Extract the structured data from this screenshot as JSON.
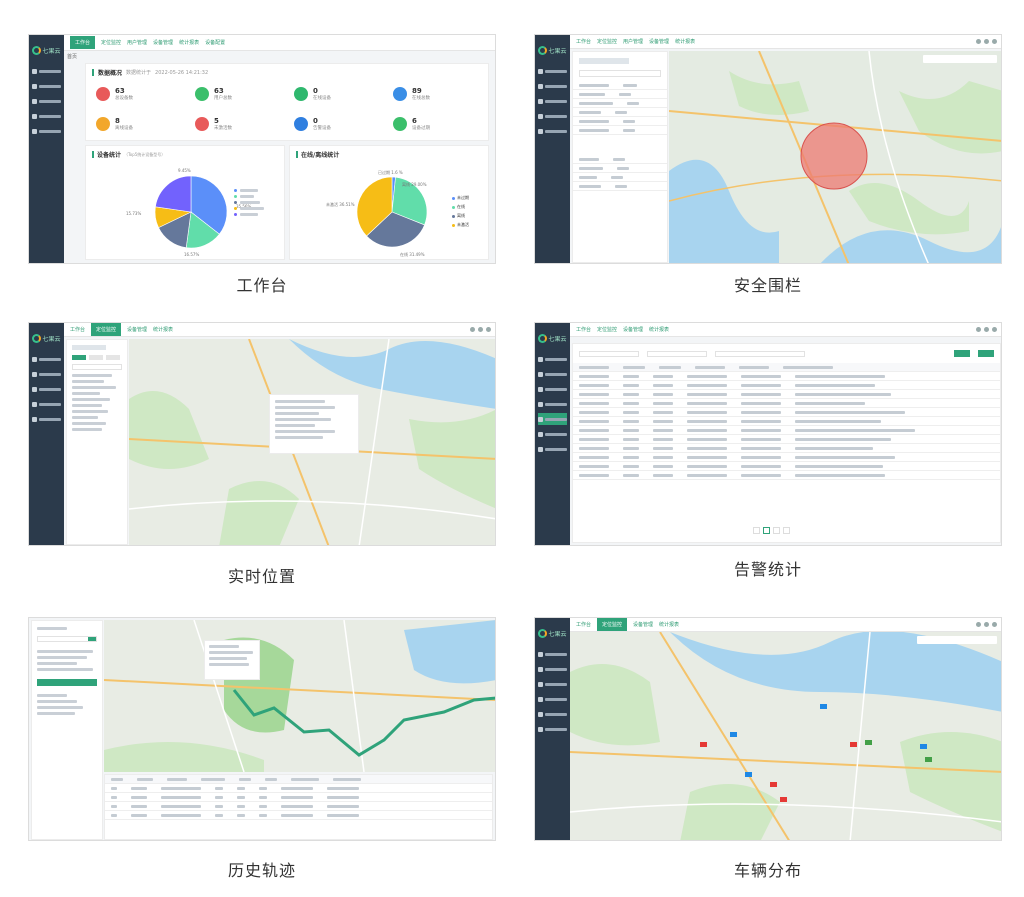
{
  "captions": [
    "工作台",
    "安全围栏",
    "实时位置",
    "告警统计",
    "历史轨迹",
    "车辆分布"
  ],
  "brand": "七果云",
  "workbench": {
    "top_tabs": [
      "工作台",
      "定位监控",
      "用户管理",
      "设备管理",
      "统计报表",
      "设备配置"
    ],
    "breadcrumb": "首页",
    "overview_title": "数据概况",
    "overview_subtitle": "数据统计于",
    "overview_time": "2022-05-26 14:21:32",
    "stats": [
      {
        "value": "63",
        "label": "总设备数",
        "color": "#e85a5a"
      },
      {
        "value": "63",
        "label": "用户总数",
        "color": "#3bbf6b"
      },
      {
        "value": "0",
        "label": "在线设备",
        "color": "#2fb86e"
      },
      {
        "value": "89",
        "label": "在线总数",
        "color": "#3a8ee6"
      },
      {
        "value": "8",
        "label": "离线设备",
        "color": "#f2a72b"
      },
      {
        "value": "5",
        "label": "未激活数",
        "color": "#e85a5a"
      },
      {
        "value": "0",
        "label": "告警设备",
        "color": "#2f7fe0"
      },
      {
        "value": "6",
        "label": "设备过期",
        "color": "#3bbf6b"
      }
    ],
    "card1_title": "设备统计",
    "card1_sub": "（Top5统计设备型号）",
    "card2_title": "在线/离线统计",
    "chart_left": {
      "labels": [
        "9.45%",
        "15.73%",
        "35.56%",
        "16.57%"
      ]
    },
    "chart_right": {
      "labels": [
        "已过期 1.6 %",
        "离线 29.00%",
        "未激活 36.51%",
        "在线 31.49%"
      ],
      "legend": [
        "未过期",
        "在线",
        "离线",
        "未激活"
      ]
    }
  },
  "chart_data": [
    {
      "type": "pie",
      "title": "设备统计",
      "values": [
        35.56,
        16.57,
        15.73,
        9.45,
        22.69
      ],
      "colors": [
        "#5b8ff9",
        "#61ddaa",
        "#65789b",
        "#f6bd16",
        "#7262fd"
      ],
      "labels": [
        "9.45%",
        "15.73%",
        "35.56%",
        "16.57%"
      ]
    },
    {
      "type": "pie",
      "title": "在线/离线统计",
      "values": [
        1.6,
        29.0,
        31.49,
        36.51
      ],
      "colors": [
        "#5b8ff9",
        "#61ddaa",
        "#65789b",
        "#f6bd16"
      ],
      "labels": [
        "已过期 1.6 %",
        "离线 29.00%",
        "未激活 36.51%",
        "在线 31.49%"
      ],
      "legend": [
        "未过期",
        "在线",
        "离线",
        "未激活"
      ]
    }
  ],
  "colors": {
    "accent": "#2fa37a",
    "sidebar": "#2b3a4b",
    "map_green": "#cfe8c4",
    "map_water": "#a8d4ef"
  }
}
